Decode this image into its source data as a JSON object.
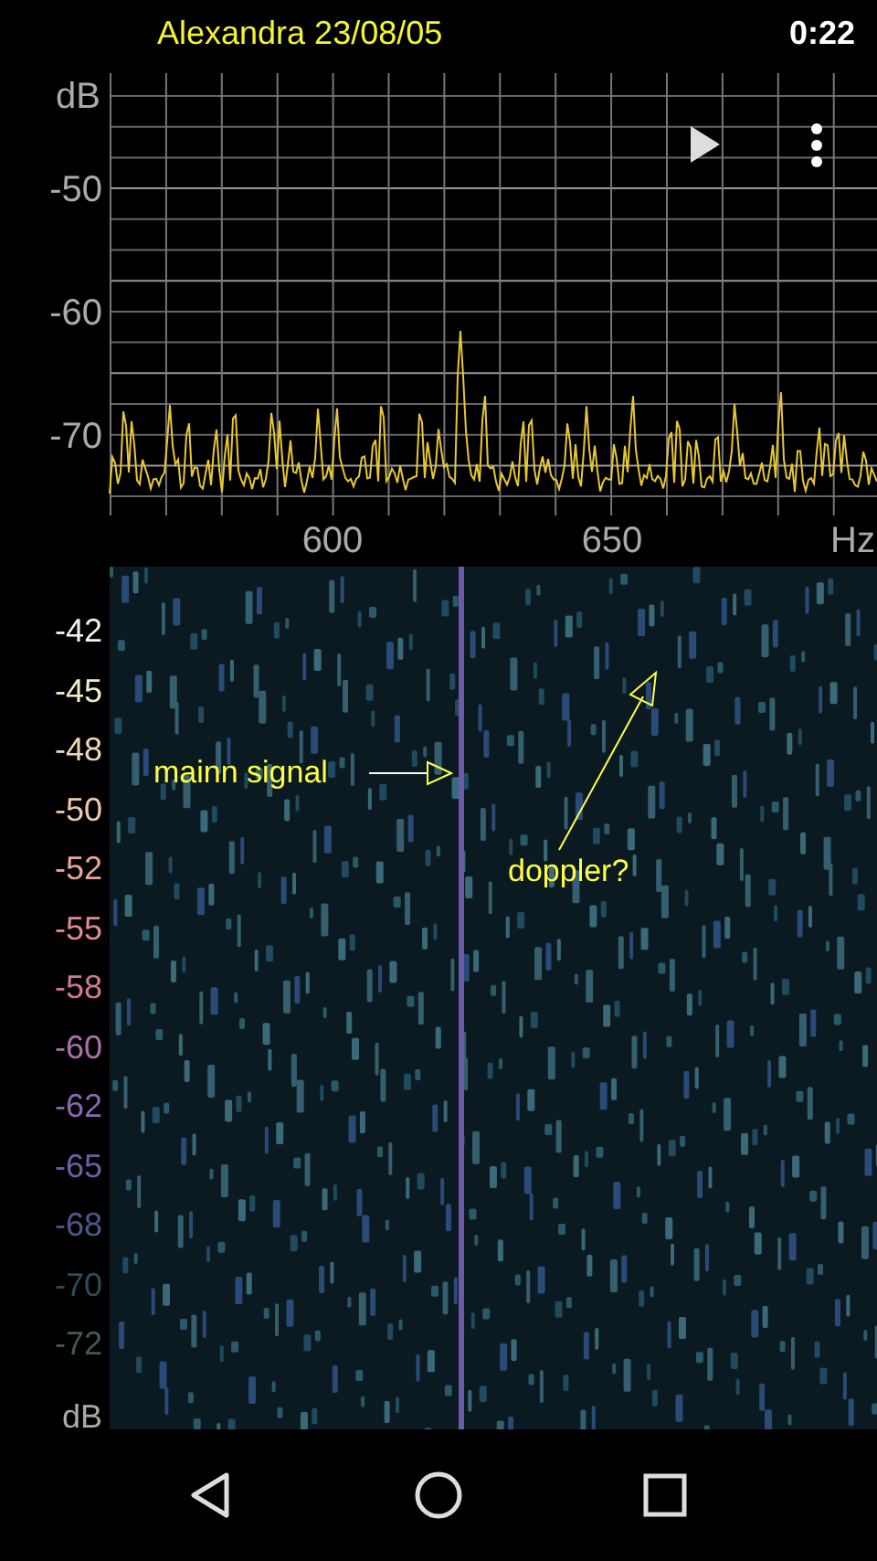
{
  "status_bar": {
    "title": "Alexandra 23/08/05",
    "time": "0:22"
  },
  "spectrum": {
    "y_unit": "dB",
    "y_labels": [
      "-50",
      "-60",
      "-70"
    ],
    "x_labels": [
      "600",
      "650"
    ],
    "x_unit": "Hz"
  },
  "spectrogram": {
    "scale": [
      {
        "label": "-42",
        "color": "#f2f2ee"
      },
      {
        "label": "-45",
        "color": "#f0ecc8"
      },
      {
        "label": "-48",
        "color": "#ecd8b8"
      },
      {
        "label": "-50",
        "color": "#eec8a8"
      },
      {
        "label": "-52",
        "color": "#e8a898"
      },
      {
        "label": "-55",
        "color": "#e08a90"
      },
      {
        "label": "-58",
        "color": "#d07898"
      },
      {
        "label": "-60",
        "color": "#a870a8"
      },
      {
        "label": "-62",
        "color": "#8a68b0"
      },
      {
        "label": "-65",
        "color": "#6a60a8"
      },
      {
        "label": "-68",
        "color": "#4a5a88"
      },
      {
        "label": "-70",
        "color": "#2e4a58"
      },
      {
        "label": "-72",
        "color": "#46585a"
      }
    ],
    "unit": "dB",
    "annotations": [
      {
        "text": "mainn signal"
      },
      {
        "text": "doppler?"
      }
    ]
  }
}
